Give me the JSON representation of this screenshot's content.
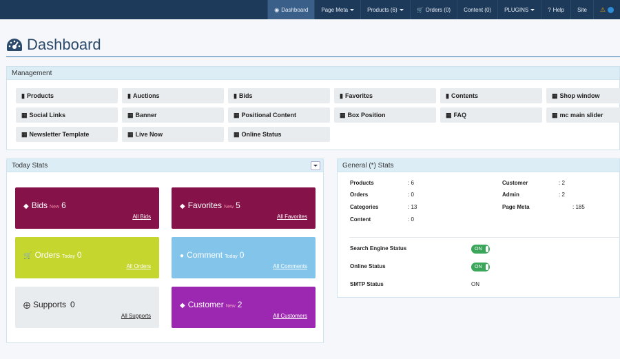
{
  "nav": {
    "items": [
      {
        "icon": "dashboard-icon",
        "label": "Dashboard",
        "active": true
      },
      {
        "label": "Page Meta",
        "dropdown": true
      },
      {
        "label": "Products (6)",
        "dropdown": true
      },
      {
        "icon": "cart-icon",
        "label": "Orders (0)"
      },
      {
        "label": "Content (0)"
      },
      {
        "label": "PLUGINS",
        "dropdown": true
      },
      {
        "icon": "help-icon",
        "label": "Help"
      },
      {
        "label": "Site"
      }
    ]
  },
  "page": {
    "title": "Dashboard"
  },
  "management": {
    "heading": "Management",
    "items": [
      {
        "icon": "file-icon",
        "label": "Products"
      },
      {
        "icon": "file-icon",
        "label": "Auctions"
      },
      {
        "icon": "file-icon",
        "label": "Bids"
      },
      {
        "icon": "file-icon",
        "label": "Favorites"
      },
      {
        "icon": "file-icon",
        "label": "Contents"
      },
      {
        "icon": "grid-icon",
        "label": "Shop window"
      },
      {
        "icon": "grid-icon",
        "label": "Social Links"
      },
      {
        "icon": "grid-icon",
        "label": "Banner"
      },
      {
        "icon": "grid-icon",
        "label": "Positional Content"
      },
      {
        "icon": "grid-icon",
        "label": "Box Position"
      },
      {
        "icon": "grid-icon",
        "label": "FAQ"
      },
      {
        "icon": "grid-icon",
        "label": "mc main slider"
      },
      {
        "icon": "grid-icon",
        "label": "Newsletter Template"
      },
      {
        "icon": "grid-icon",
        "label": "Live Now"
      },
      {
        "icon": "grid-icon",
        "label": "Online Status"
      }
    ]
  },
  "today": {
    "heading": "Today Stats",
    "tiles": [
      {
        "icon": "tag-icon",
        "title": "Bids",
        "sub": "New",
        "count": "6",
        "link": "All Bids",
        "bg": "#851248",
        "color": "#ffffff",
        "sub_color": "#f08aa8"
      },
      {
        "icon": "tag-icon",
        "title": "Favorites",
        "sub": "New",
        "count": "5",
        "link": "All Favorites",
        "bg": "#851248",
        "color": "#ffffff",
        "sub_color": "#f08aa8"
      },
      {
        "icon": "cart-icon",
        "title": "Orders",
        "sub": "Today",
        "count": "0",
        "link": "All Orders",
        "bg": "#c5d62e",
        "color": "#ffffff",
        "sub_color": "#ffffff"
      },
      {
        "icon": "user-icon",
        "title": "Comment",
        "sub": "Today",
        "count": "0",
        "link": "All Comments",
        "bg": "#83c5ea",
        "color": "#ffffff",
        "sub_color": "#ffffff"
      },
      {
        "icon": "lifebuoy-icon",
        "title": "Supports",
        "sub": "",
        "count": "0",
        "link": "All Supports",
        "bg": "#e9ecef",
        "color": "#222222",
        "sub_color": "#222222"
      },
      {
        "icon": "tag-icon",
        "title": "Customer",
        "sub": "New",
        "count": "2",
        "link": "All Customers",
        "bg": "#9c27b0",
        "color": "#ffffff",
        "sub_color": "#f3a8c8"
      }
    ]
  },
  "general": {
    "heading": "General (*) Stats",
    "left": [
      {
        "label": "Products",
        "value": ": 6"
      },
      {
        "label": "Orders",
        "value": ": 0"
      },
      {
        "label": "Categories",
        "value": ": 13"
      },
      {
        "label": "Content",
        "value": ": 0"
      }
    ],
    "right": [
      {
        "label": "Customer",
        "value": ": 2"
      },
      {
        "label": "Admin",
        "value": ": 2"
      },
      {
        "label": "Page Meta",
        "value": ": 185"
      }
    ],
    "status": [
      {
        "label": "Search Engine Status",
        "value": "ON",
        "toggle": true
      },
      {
        "label": "Online Status",
        "value": "ON",
        "toggle": true
      },
      {
        "label": "SMTP Status",
        "value": "ON",
        "toggle": false
      }
    ]
  }
}
